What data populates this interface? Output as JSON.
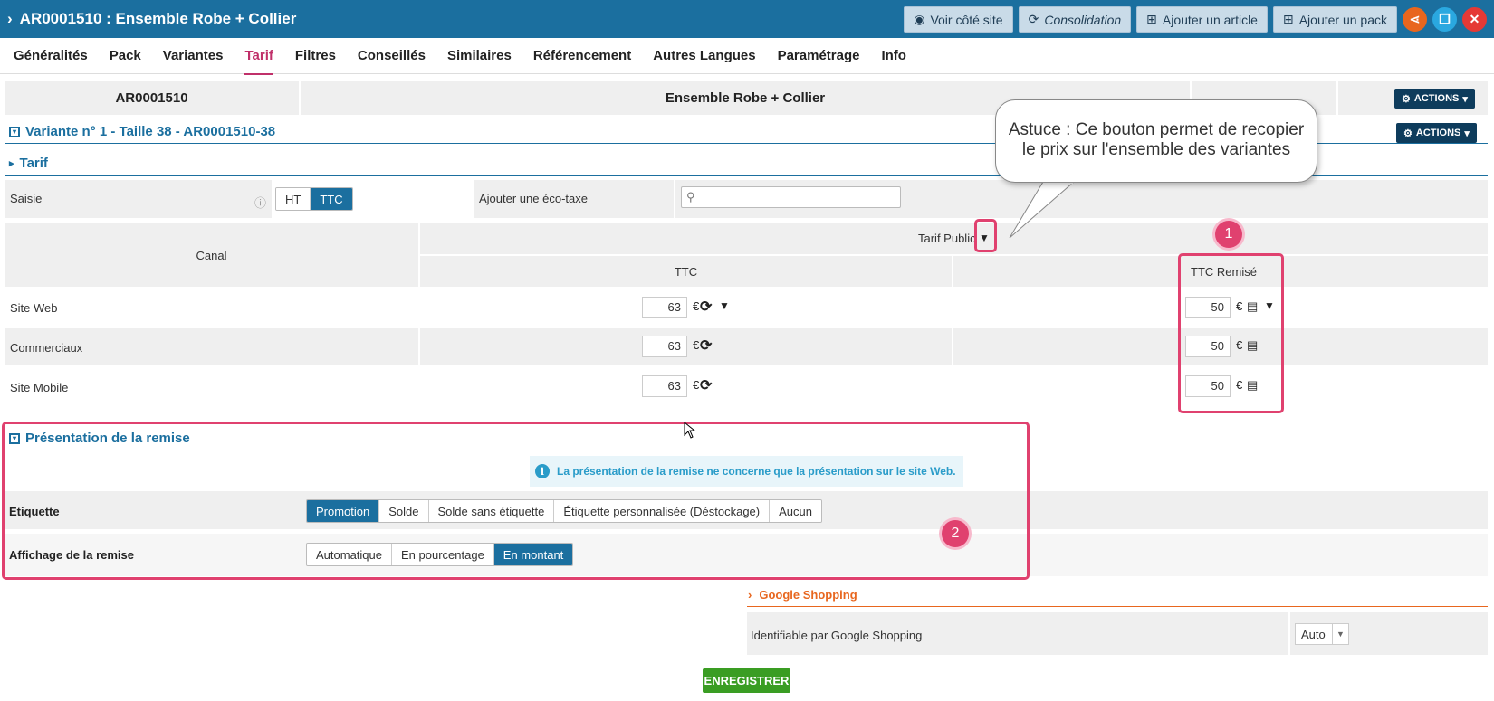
{
  "header": {
    "title": "AR0001510 : Ensemble Robe + Collier",
    "buttons": [
      {
        "label": "Voir côté site"
      },
      {
        "label": "Consolidation"
      },
      {
        "label": "Ajouter un article"
      },
      {
        "label": "Ajouter un pack"
      }
    ]
  },
  "tabs": [
    "Généralités",
    "Pack",
    "Variantes",
    "Tarif",
    "Filtres",
    "Conseillés",
    "Similaires",
    "Référencement",
    "Autres Langues",
    "Paramétrage",
    "Info"
  ],
  "article": {
    "code": "AR0001510",
    "name": "Ensemble Robe + Collier",
    "actions_label": "ACTIONS"
  },
  "variante": {
    "title": "Variante n° 1 - Taille 38 - AR0001510-38",
    "actions_label": "ACTIONS"
  },
  "tarif": {
    "title": "Tarif",
    "saisie_label": "Saisie",
    "toggle": [
      "HT",
      "TTC"
    ],
    "eco_label": "Ajouter une éco-taxe",
    "canal_header": "Canal",
    "tarif_public": "Tarif Public",
    "ttc_header": "TTC",
    "ttc_remise_header": "TTC Remisé",
    "currency": "€",
    "rows": [
      {
        "canal": "Site Web",
        "ttc": "63",
        "remise": "50"
      },
      {
        "canal": "Commerciaux",
        "ttc": "63",
        "remise": "50"
      },
      {
        "canal": "Site Mobile",
        "ttc": "63",
        "remise": "50"
      }
    ]
  },
  "callout": {
    "line1": "Astuce : Ce bouton permet de recopier",
    "line2": "le prix sur l'ensemble des variantes"
  },
  "badges": [
    "1",
    "2"
  ],
  "remise": {
    "title": "Présentation de la remise",
    "info": "La présentation de la remise ne concerne que la présentation sur le site Web.",
    "etiquette_label": "Etiquette",
    "etiquette_options": [
      "Promotion",
      "Solde",
      "Solde sans étiquette",
      "Étiquette personnalisée (Déstockage)",
      "Aucun"
    ],
    "affichage_label": "Affichage de la remise",
    "affichage_options": [
      "Automatique",
      "En pourcentage",
      "En montant"
    ]
  },
  "google": {
    "title": "Google Shopping",
    "label": "Identifiable par Google Shopping",
    "value": "Auto"
  },
  "save_label": "ENREGISTRER",
  "colors": {
    "primary": "#1b6f9f",
    "accent": "#c0306a",
    "highlight": "#e0416f",
    "save": "#3a9d23",
    "orange": "#e8661e"
  }
}
